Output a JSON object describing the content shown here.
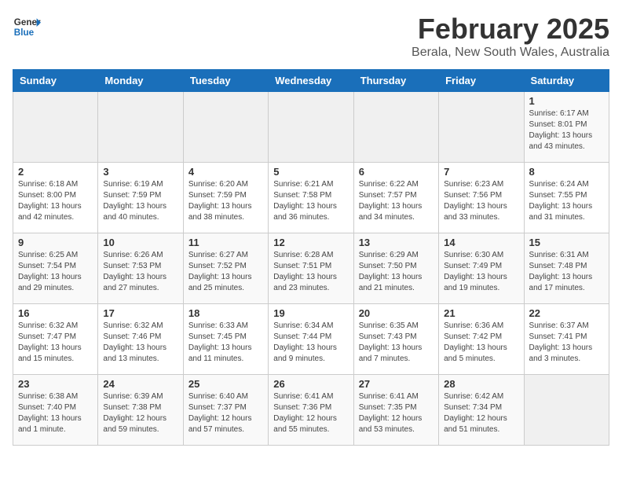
{
  "header": {
    "logo_general": "General",
    "logo_blue": "Blue",
    "title": "February 2025",
    "subtitle": "Berala, New South Wales, Australia"
  },
  "weekdays": [
    "Sunday",
    "Monday",
    "Tuesday",
    "Wednesday",
    "Thursday",
    "Friday",
    "Saturday"
  ],
  "weeks": [
    [
      {
        "day": "",
        "info": ""
      },
      {
        "day": "",
        "info": ""
      },
      {
        "day": "",
        "info": ""
      },
      {
        "day": "",
        "info": ""
      },
      {
        "day": "",
        "info": ""
      },
      {
        "day": "",
        "info": ""
      },
      {
        "day": "1",
        "info": "Sunrise: 6:17 AM\nSunset: 8:01 PM\nDaylight: 13 hours\nand 43 minutes."
      }
    ],
    [
      {
        "day": "2",
        "info": "Sunrise: 6:18 AM\nSunset: 8:00 PM\nDaylight: 13 hours\nand 42 minutes."
      },
      {
        "day": "3",
        "info": "Sunrise: 6:19 AM\nSunset: 7:59 PM\nDaylight: 13 hours\nand 40 minutes."
      },
      {
        "day": "4",
        "info": "Sunrise: 6:20 AM\nSunset: 7:59 PM\nDaylight: 13 hours\nand 38 minutes."
      },
      {
        "day": "5",
        "info": "Sunrise: 6:21 AM\nSunset: 7:58 PM\nDaylight: 13 hours\nand 36 minutes."
      },
      {
        "day": "6",
        "info": "Sunrise: 6:22 AM\nSunset: 7:57 PM\nDaylight: 13 hours\nand 34 minutes."
      },
      {
        "day": "7",
        "info": "Sunrise: 6:23 AM\nSunset: 7:56 PM\nDaylight: 13 hours\nand 33 minutes."
      },
      {
        "day": "8",
        "info": "Sunrise: 6:24 AM\nSunset: 7:55 PM\nDaylight: 13 hours\nand 31 minutes."
      }
    ],
    [
      {
        "day": "9",
        "info": "Sunrise: 6:25 AM\nSunset: 7:54 PM\nDaylight: 13 hours\nand 29 minutes."
      },
      {
        "day": "10",
        "info": "Sunrise: 6:26 AM\nSunset: 7:53 PM\nDaylight: 13 hours\nand 27 minutes."
      },
      {
        "day": "11",
        "info": "Sunrise: 6:27 AM\nSunset: 7:52 PM\nDaylight: 13 hours\nand 25 minutes."
      },
      {
        "day": "12",
        "info": "Sunrise: 6:28 AM\nSunset: 7:51 PM\nDaylight: 13 hours\nand 23 minutes."
      },
      {
        "day": "13",
        "info": "Sunrise: 6:29 AM\nSunset: 7:50 PM\nDaylight: 13 hours\nand 21 minutes."
      },
      {
        "day": "14",
        "info": "Sunrise: 6:30 AM\nSunset: 7:49 PM\nDaylight: 13 hours\nand 19 minutes."
      },
      {
        "day": "15",
        "info": "Sunrise: 6:31 AM\nSunset: 7:48 PM\nDaylight: 13 hours\nand 17 minutes."
      }
    ],
    [
      {
        "day": "16",
        "info": "Sunrise: 6:32 AM\nSunset: 7:47 PM\nDaylight: 13 hours\nand 15 minutes."
      },
      {
        "day": "17",
        "info": "Sunrise: 6:32 AM\nSunset: 7:46 PM\nDaylight: 13 hours\nand 13 minutes."
      },
      {
        "day": "18",
        "info": "Sunrise: 6:33 AM\nSunset: 7:45 PM\nDaylight: 13 hours\nand 11 minutes."
      },
      {
        "day": "19",
        "info": "Sunrise: 6:34 AM\nSunset: 7:44 PM\nDaylight: 13 hours\nand 9 minutes."
      },
      {
        "day": "20",
        "info": "Sunrise: 6:35 AM\nSunset: 7:43 PM\nDaylight: 13 hours\nand 7 minutes."
      },
      {
        "day": "21",
        "info": "Sunrise: 6:36 AM\nSunset: 7:42 PM\nDaylight: 13 hours\nand 5 minutes."
      },
      {
        "day": "22",
        "info": "Sunrise: 6:37 AM\nSunset: 7:41 PM\nDaylight: 13 hours\nand 3 minutes."
      }
    ],
    [
      {
        "day": "23",
        "info": "Sunrise: 6:38 AM\nSunset: 7:40 PM\nDaylight: 13 hours\nand 1 minute."
      },
      {
        "day": "24",
        "info": "Sunrise: 6:39 AM\nSunset: 7:38 PM\nDaylight: 12 hours\nand 59 minutes."
      },
      {
        "day": "25",
        "info": "Sunrise: 6:40 AM\nSunset: 7:37 PM\nDaylight: 12 hours\nand 57 minutes."
      },
      {
        "day": "26",
        "info": "Sunrise: 6:41 AM\nSunset: 7:36 PM\nDaylight: 12 hours\nand 55 minutes."
      },
      {
        "day": "27",
        "info": "Sunrise: 6:41 AM\nSunset: 7:35 PM\nDaylight: 12 hours\nand 53 minutes."
      },
      {
        "day": "28",
        "info": "Sunrise: 6:42 AM\nSunset: 7:34 PM\nDaylight: 12 hours\nand 51 minutes."
      },
      {
        "day": "",
        "info": ""
      }
    ]
  ]
}
